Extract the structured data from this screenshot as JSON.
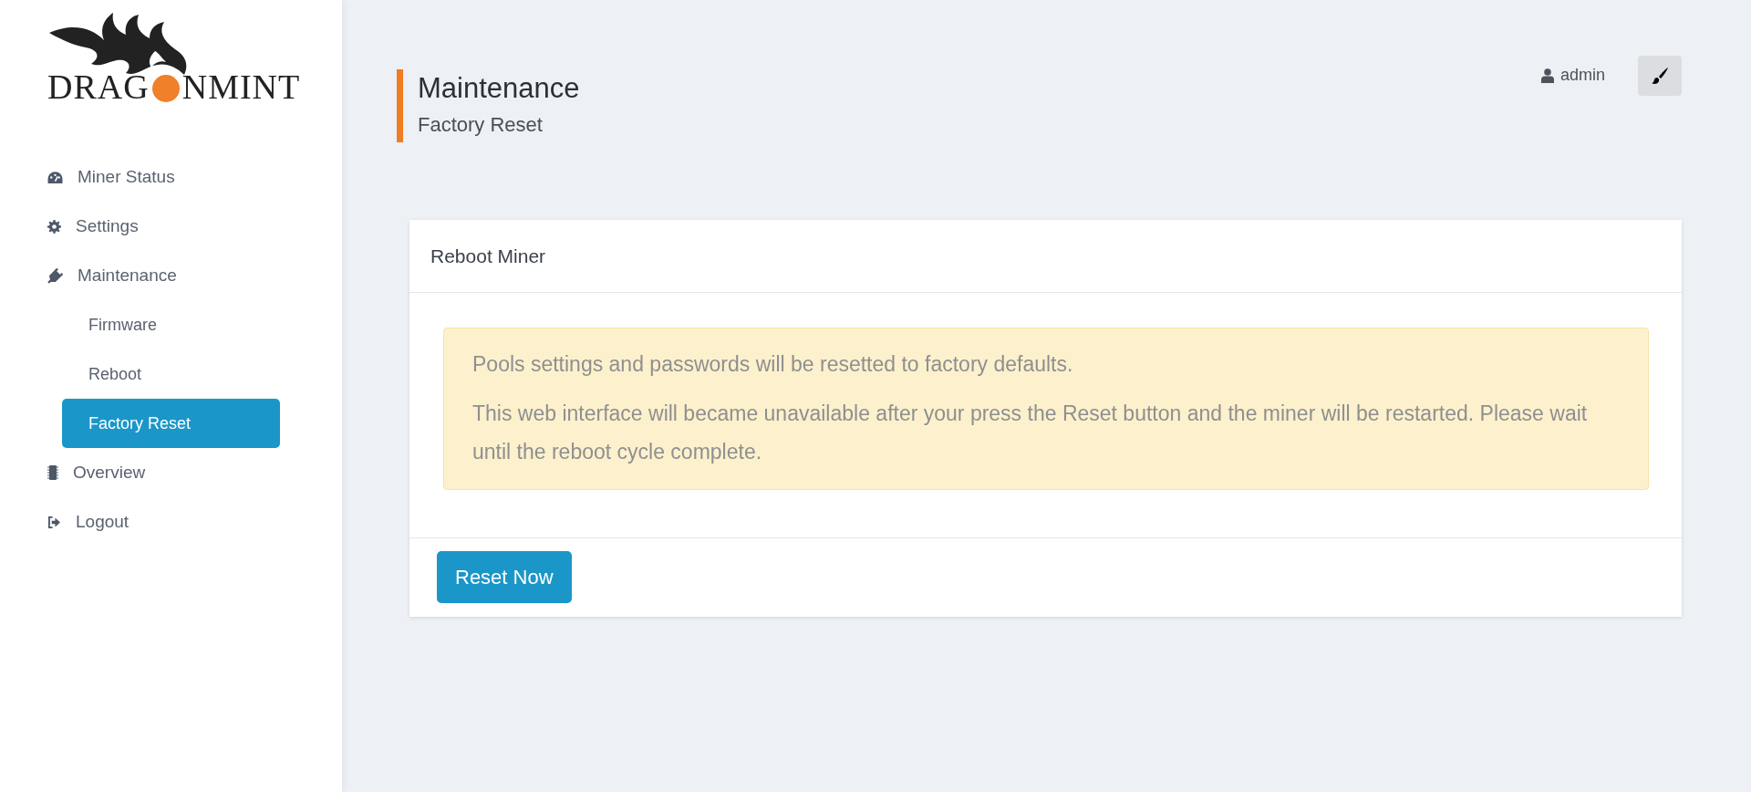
{
  "logo": {
    "text_start": "DRAG",
    "text_end": "NMINT"
  },
  "sidebar": {
    "items": [
      {
        "label": "Miner Status",
        "kind": "gauge",
        "selected": false
      },
      {
        "label": "Settings",
        "kind": "gear",
        "selected": false
      },
      {
        "label": "Maintenance",
        "kind": "plug",
        "selected": false,
        "children": [
          {
            "label": "Firmware",
            "selected": false
          },
          {
            "label": "Reboot",
            "selected": false
          },
          {
            "label": "Factory Reset",
            "selected": true
          }
        ]
      },
      {
        "label": "Overview",
        "kind": "chip",
        "selected": false
      },
      {
        "label": "Logout",
        "kind": "logout",
        "selected": false
      }
    ]
  },
  "header": {
    "title": "Maintenance",
    "subtitle": "Factory Reset",
    "user": "admin"
  },
  "card": {
    "title": "Reboot Miner",
    "alert": [
      "Pools settings and passwords will be resetted to factory defaults.",
      "This web interface will became unavailable after your press the Reset button and the miner will be restarted. Please wait until the reboot cycle complete."
    ],
    "button": "Reset Now"
  }
}
